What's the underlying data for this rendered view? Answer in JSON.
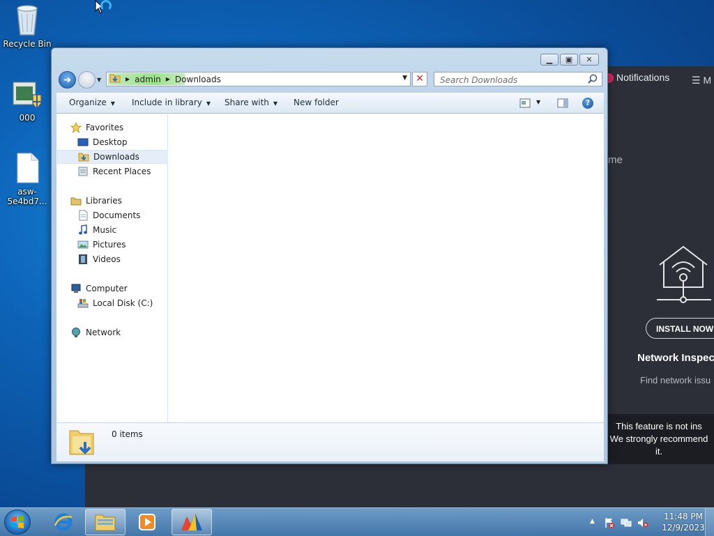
{
  "desktop": {
    "icons": [
      {
        "label": "Recycle Bin"
      },
      {
        "label": "000"
      },
      {
        "label": "asw-5e4bd7..."
      }
    ]
  },
  "background_app": {
    "notifications_label": "Notifications",
    "menu_label": "M",
    "partial_heading": "me",
    "install_button": "INSTALL NOW",
    "feature_title": "Network Inspec",
    "feature_desc": "Find network issu",
    "toast_line1": "This feature is not ins",
    "toast_line2": "We strongly recommend",
    "toast_line3": "it."
  },
  "window": {
    "address": {
      "segments": [
        "admin",
        "Downloads"
      ]
    },
    "search": {
      "placeholder": "Search Downloads"
    },
    "toolbar": {
      "organize": "Organize",
      "include_in_library": "Include in library",
      "share_with": "Share with",
      "new_folder": "New folder",
      "help_symbol": "?"
    },
    "nav": {
      "favorites": "Favorites",
      "desktop": "Desktop",
      "downloads": "Downloads",
      "recent_places": "Recent Places",
      "libraries": "Libraries",
      "documents": "Documents",
      "music": "Music",
      "pictures": "Pictures",
      "videos": "Videos",
      "computer": "Computer",
      "local_disk": "Local Disk (C:)",
      "network": "Network"
    },
    "details": {
      "item_count": "0 items"
    }
  },
  "taskbar": {
    "clock": {
      "time": "11:48 PM",
      "date": "12/9/2023"
    }
  },
  "colors": {
    "accent": "#1c5fb3",
    "background_app": "#2c2f38",
    "address_highlight": "#8fe07c"
  }
}
